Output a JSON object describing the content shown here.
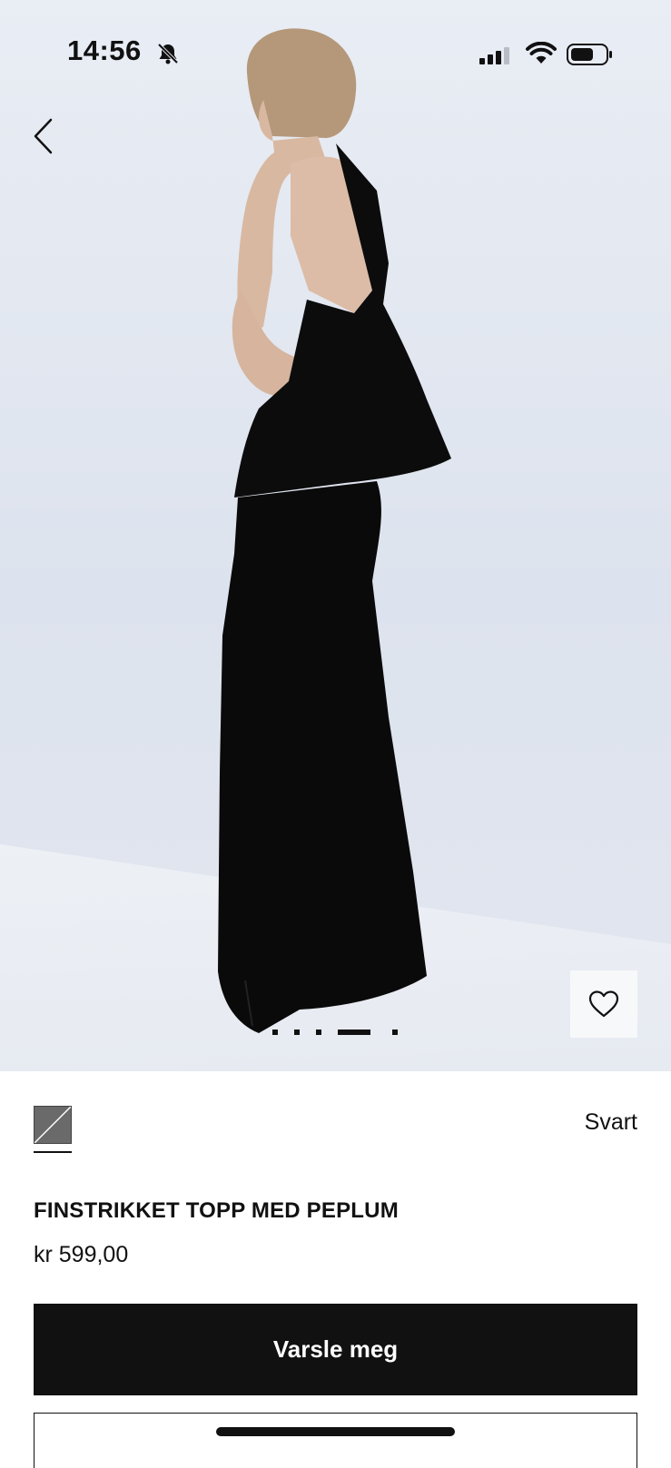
{
  "status_bar": {
    "time": "14:56",
    "icons": [
      "bell-slash-icon",
      "cellular-signal-icon",
      "wifi-icon",
      "battery-icon"
    ]
  },
  "hero": {
    "image_icons": [
      "back-chevron-icon",
      "heart-icon"
    ],
    "gallery": {
      "count": 5,
      "active_index": 3
    }
  },
  "product": {
    "color_name": "Svart",
    "title": "FINSTRIKKET TOPP MED PEPLUM",
    "price": "kr 599,00",
    "notify_label": "Varsle meg"
  },
  "colors": {
    "accent": "#111111",
    "background": "#ffffff",
    "hero_background": "#e2e7f0"
  }
}
